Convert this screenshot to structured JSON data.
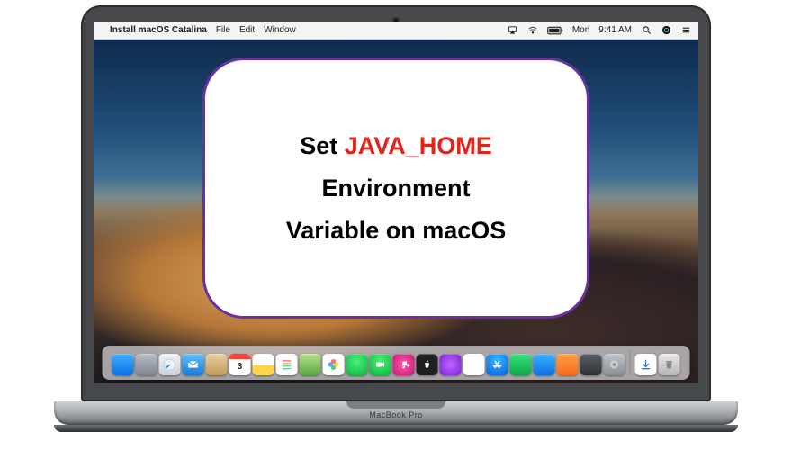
{
  "menubar": {
    "apple": "",
    "app_name": "Install macOS Catalina",
    "menus": [
      "File",
      "Edit",
      "Window"
    ],
    "status": {
      "airplay": "airplay",
      "wifi": "wifi",
      "battery": "battery",
      "day": "Mon",
      "time": "9:41 AM",
      "spotlight": "search",
      "siri": "siri",
      "notifications": "notifications"
    }
  },
  "overlay": {
    "line1_a": "Set ",
    "line1_b": "JAVA_HOME",
    "line2": "Environment",
    "line3": "Variable on macOS"
  },
  "calendar_day": "3",
  "dock": [
    {
      "name": "finder",
      "label": "Finder"
    },
    {
      "name": "launchpad",
      "label": "Launchpad"
    },
    {
      "name": "safari",
      "label": "Safari"
    },
    {
      "name": "mail",
      "label": "Mail"
    },
    {
      "name": "contacts",
      "label": "Contacts"
    },
    {
      "name": "calendar",
      "label": "Calendar"
    },
    {
      "name": "notes",
      "label": "Notes"
    },
    {
      "name": "reminders",
      "label": "Reminders"
    },
    {
      "name": "maps",
      "label": "Maps"
    },
    {
      "name": "photos",
      "label": "Photos"
    },
    {
      "name": "messages",
      "label": "Messages"
    },
    {
      "name": "facetime",
      "label": "FaceTime"
    },
    {
      "name": "itunes",
      "label": "iTunes"
    },
    {
      "name": "tv",
      "label": "TV"
    },
    {
      "name": "podcast",
      "label": "Podcasts"
    },
    {
      "name": "news",
      "label": "News"
    },
    {
      "name": "appstore",
      "label": "App Store"
    },
    {
      "name": "numbers",
      "label": "Numbers"
    },
    {
      "name": "keynote",
      "label": "Keynote"
    },
    {
      "name": "pages",
      "label": "Pages"
    },
    {
      "name": "mission",
      "label": "Mission Control"
    },
    {
      "name": "sysp",
      "label": "System Preferences"
    }
  ],
  "dock_right": [
    {
      "name": "dl",
      "label": "Downloads"
    },
    {
      "name": "trash",
      "label": "Trash"
    }
  ],
  "brand": "MacBook Pro",
  "colors": {
    "card_border": "#6b2fa0",
    "emphasis": "#e2231a"
  }
}
